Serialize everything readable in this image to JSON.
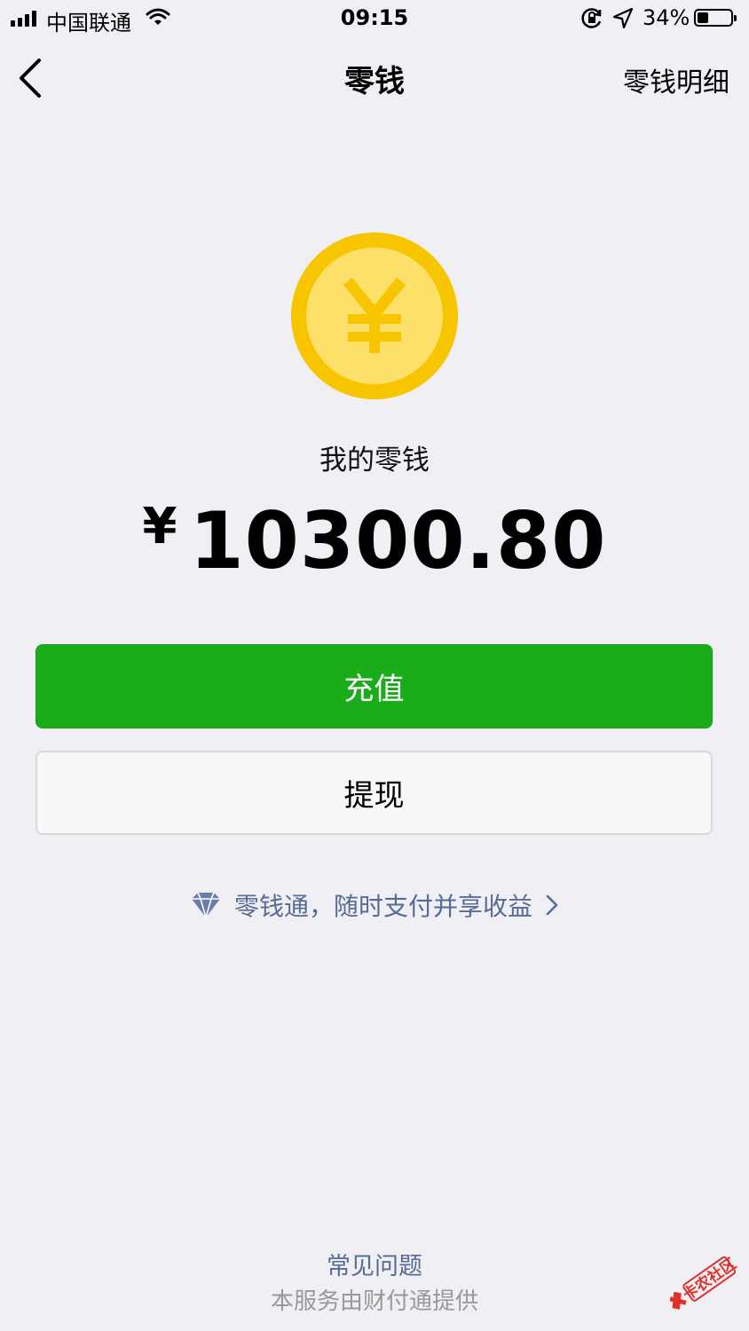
{
  "status_bar": {
    "carrier": "中国联通",
    "time": "09:15",
    "battery_percent": "34%",
    "battery_level": 0.34,
    "icons": [
      "signal-icon",
      "wifi-icon",
      "orientation-lock-icon",
      "location-icon",
      "battery-icon"
    ]
  },
  "nav": {
    "back_icon": "chevron-left-icon",
    "title": "零钱",
    "right_action": "零钱明细"
  },
  "balance": {
    "coin_icon": "yuan-coin-icon",
    "label": "我的零钱",
    "currency_symbol": "¥",
    "amount": "10300.80"
  },
  "buttons": {
    "recharge": "充值",
    "withdraw": "提现"
  },
  "promo": {
    "icon": "diamond-icon",
    "text": "零钱通，随时支付并享收益",
    "arrow_icon": "chevron-right-icon"
  },
  "footer": {
    "faq": "常见问题",
    "provider": "本服务由财付通提供"
  },
  "watermark": {
    "text": "卡农社区"
  },
  "colors": {
    "background": "#efeff4",
    "primary_green": "#1aad19",
    "link_blue": "#576b95",
    "coin_outer": "#f7c600",
    "coin_inner": "#fde06a"
  }
}
